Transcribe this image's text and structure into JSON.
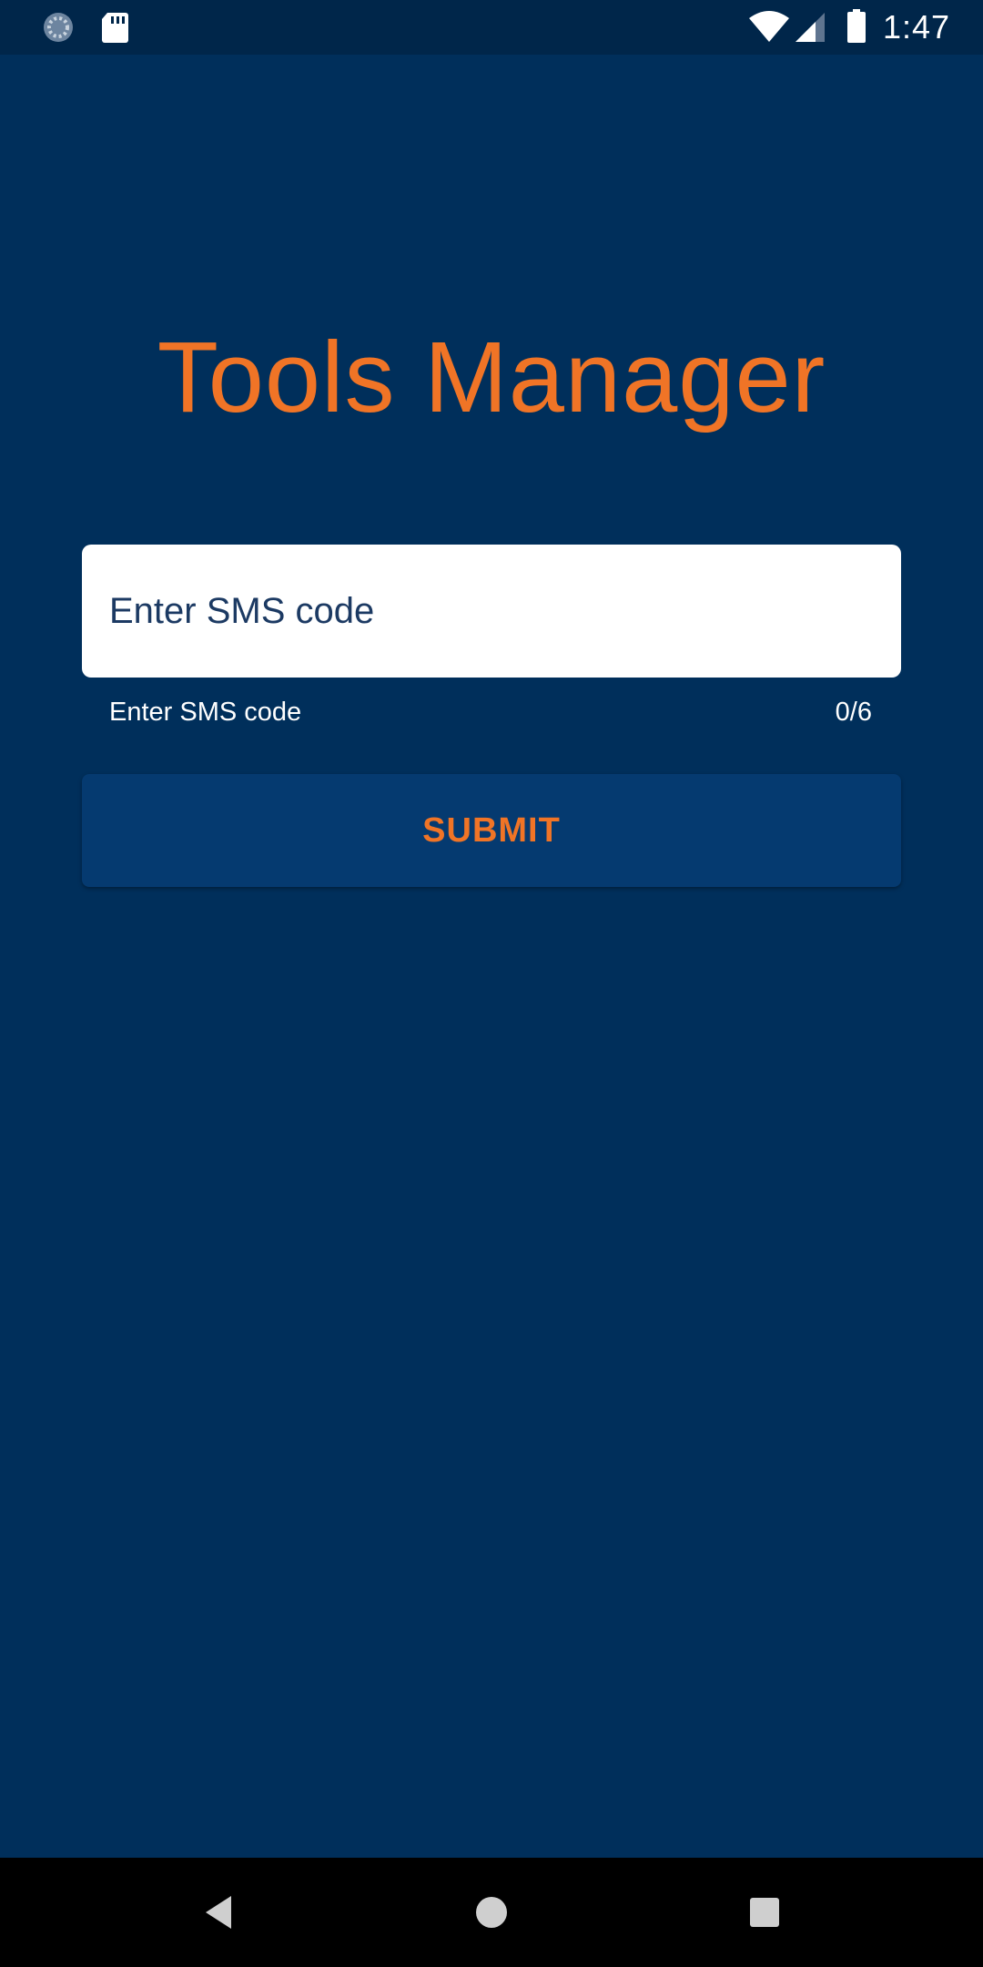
{
  "status_bar": {
    "time": "1:47",
    "icons": [
      "sync-icon",
      "sd-card-icon",
      "wifi-icon",
      "cell-signal-icon",
      "battery-icon"
    ]
  },
  "app": {
    "title": "Tools Manager"
  },
  "sms_form": {
    "input_placeholder": "Enter SMS code",
    "input_value": "",
    "helper_text": "Enter SMS code",
    "counter": "0/6",
    "submit_label": "SUBMIT"
  },
  "nav_bar": {
    "buttons": [
      "back-icon",
      "home-icon",
      "recents-icon"
    ]
  },
  "colors": {
    "background": "#002f5b",
    "accent": "#f07426",
    "button": "#053a70",
    "status_bar": "#00264a"
  }
}
